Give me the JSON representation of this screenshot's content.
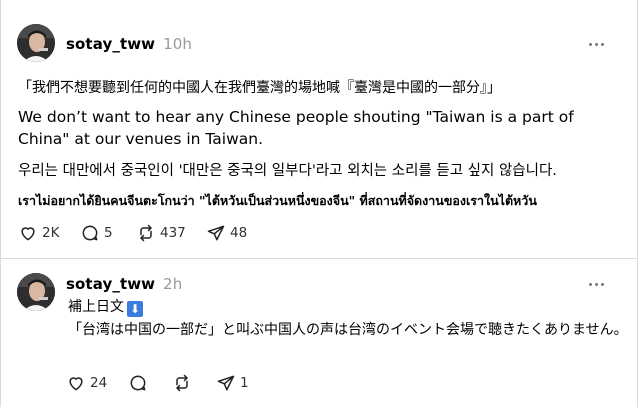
{
  "posts": [
    {
      "username": "sotay_tww",
      "time": "10h",
      "lines": {
        "zh": "「我們不想要聽到任何的中國人在我們臺灣的場地喊『臺灣是中國的一部分』」",
        "en": "We don’t want to hear any Chinese people shouting \"Taiwan is a part of China\" at our venues in Taiwan.",
        "ko": "우리는 대만에서 중국인이 '대만은 중국의 일부다'라고 외치는 소리를 듣고 싶지 않습니다.",
        "th": "เราไม่อยากได้ยินคนจีนตะโกนว่า \"ไต้หวันเป็นส่วนหนึ่งของจีน\" ที่สถานที่จัดงานของเราในไต้หวัน"
      },
      "counts": {
        "likes": "2K",
        "replies": "5",
        "reposts": "437",
        "shares": "48"
      }
    },
    {
      "username": "sotay_tww",
      "time": "2h",
      "lines": {
        "header": "補上日文",
        "header_emoji": "⬇",
        "ja": "「台湾は中国の一部だ」と叫ぶ中国人の声は台湾のイベント会場で聴きたくありません。"
      },
      "counts": {
        "likes": "24",
        "replies": "",
        "reposts": "",
        "shares": "1"
      }
    }
  ],
  "icons": [
    "avatar",
    "more-icon",
    "heart-icon",
    "comment-icon",
    "repost-icon",
    "share-icon"
  ],
  "colors": {
    "muted": "#999999",
    "divider": "#dbdbdb",
    "emoji_blue": "#3b7ddd"
  }
}
